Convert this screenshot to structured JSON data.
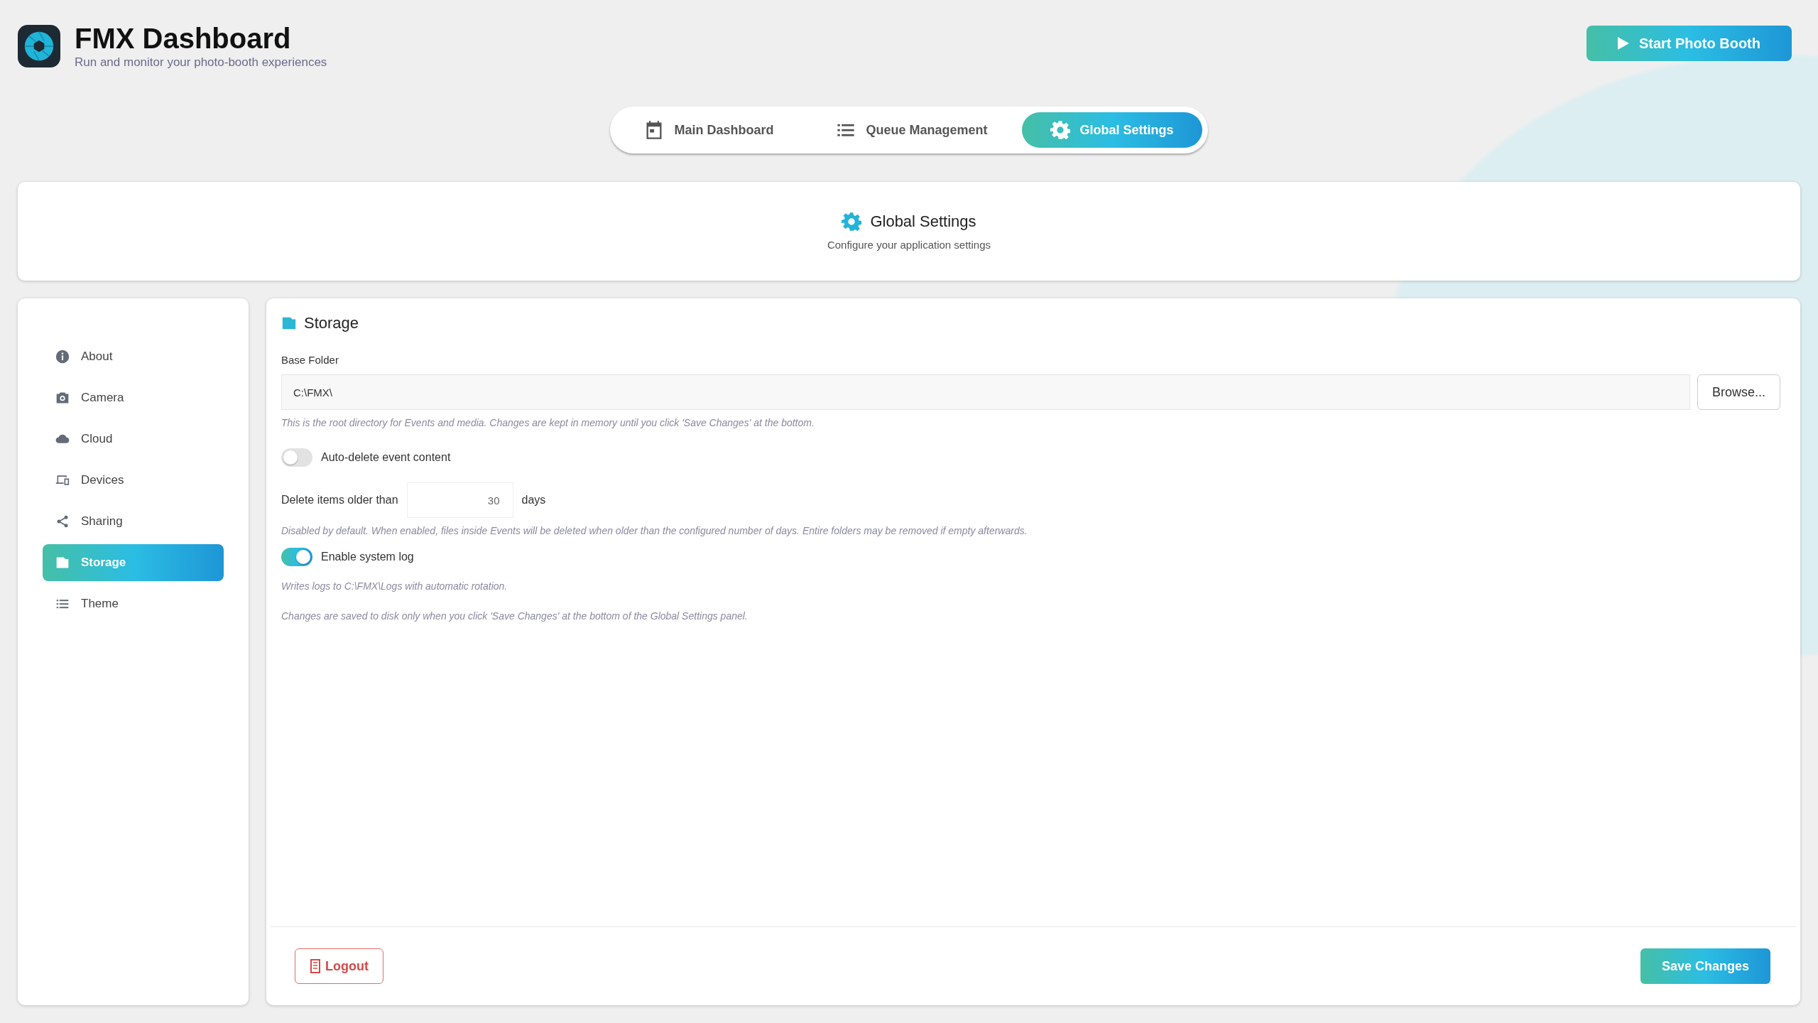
{
  "app": {
    "title": "FMX Dashboard",
    "subtitle": "Run and monitor your photo-booth experiences",
    "start_button": "Start Photo Booth"
  },
  "tabs": [
    {
      "label": "Main Dashboard",
      "kind": "calendar",
      "selected": false
    },
    {
      "label": "Queue Management",
      "kind": "list",
      "selected": false
    },
    {
      "label": "Global Settings",
      "kind": "gear",
      "selected": true
    }
  ],
  "page_header": {
    "title": "Global Settings",
    "subtitle": "Configure your application settings"
  },
  "sidebar": {
    "items": [
      {
        "label": "About",
        "kind": "info",
        "selected": false
      },
      {
        "label": "Camera",
        "kind": "camera",
        "selected": false
      },
      {
        "label": "Cloud",
        "kind": "cloud",
        "selected": false
      },
      {
        "label": "Devices",
        "kind": "devices",
        "selected": false
      },
      {
        "label": "Sharing",
        "kind": "share",
        "selected": false
      },
      {
        "label": "Storage",
        "kind": "storage",
        "selected": true
      },
      {
        "label": "Theme",
        "kind": "list",
        "selected": false
      }
    ]
  },
  "storage": {
    "title": "Storage",
    "base_folder": {
      "label": "Base Folder",
      "value": "C:\\FMX\\",
      "button": "Browse...",
      "hint": "This is the root directory for Events and media. Changes are kept in memory until you click 'Save Changes' at the bottom."
    },
    "auto_delete": {
      "label": "Auto-delete event content",
      "on": false
    },
    "delete_after": {
      "label": "Delete items older than",
      "value": "30",
      "unit": "days",
      "hint": "Disabled by default. When enabled, files inside Events will be deleted when older than the configured number of days. Entire folders may be removed if empty afterwards."
    },
    "system_log": {
      "label": "Enable system log",
      "on": true,
      "hint": "Writes logs to C:\\FMX\\Logs with automatic rotation."
    },
    "note": "Changes are saved to disk only when you click 'Save Changes' at the bottom of the Global Settings panel."
  },
  "footer": {
    "logout": "Logout",
    "save": "Save Changes"
  }
}
